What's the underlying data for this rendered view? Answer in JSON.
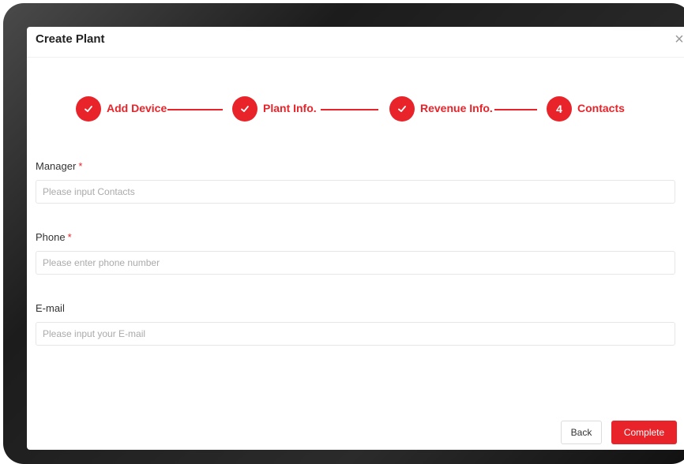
{
  "modal": {
    "title": "Create Plant"
  },
  "steps": [
    {
      "label": "Add Device",
      "status": "done",
      "marker": "✓"
    },
    {
      "label": "Plant Info.",
      "status": "done",
      "marker": "✓"
    },
    {
      "label": "Revenue Info.",
      "status": "done",
      "marker": "✓"
    },
    {
      "label": "Contacts",
      "status": "active",
      "marker": "4"
    }
  ],
  "form": {
    "manager": {
      "label": "Manager",
      "required_mark": "*",
      "placeholder": "Please input Contacts",
      "value": ""
    },
    "phone": {
      "label": "Phone",
      "required_mark": "*",
      "placeholder": "Please enter phone number",
      "value": ""
    },
    "email": {
      "label": "E-mail",
      "placeholder": "Please input your E-mail",
      "value": ""
    }
  },
  "footer": {
    "back_label": "Back",
    "complete_label": "Complete"
  },
  "colors": {
    "accent": "#e8242a",
    "bezel": "#1c1c1c"
  },
  "icons": {
    "close": "close-icon",
    "step_done": "check-icon"
  }
}
